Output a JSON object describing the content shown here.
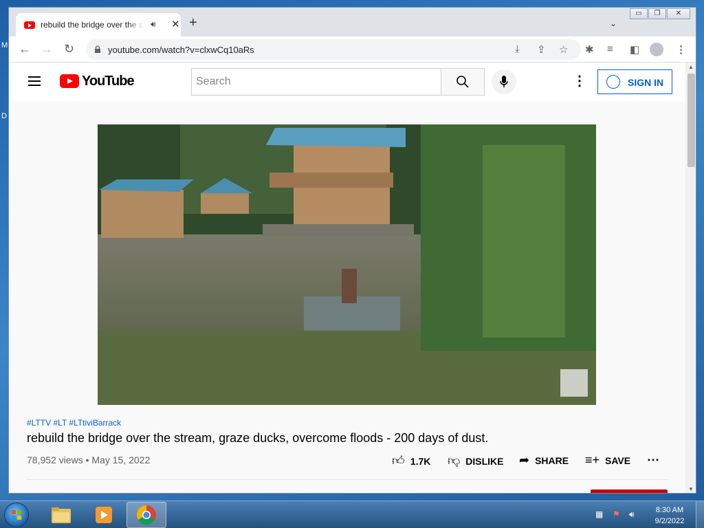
{
  "desktop": {
    "edge_letters": [
      "M",
      "D"
    ]
  },
  "browser": {
    "tab": {
      "title": "rebuild the bridge over the s",
      "audio_icon": "speaker-icon",
      "close_icon": "close-icon"
    },
    "window_controls": {
      "minimize": "▭",
      "restore": "❐",
      "close": "✕"
    },
    "url": "youtube.com/watch?v=clxwCq10aRs"
  },
  "youtube": {
    "logo_text": "YouTube",
    "search_placeholder": "Search",
    "signin_label": "SIGN IN",
    "video": {
      "hashtags": "#LTTV #LT #LTtiviBarrack",
      "title": "rebuild the bridge over the stream, graze ducks, overcome floods - 200 days of dust.",
      "meta": "78,952 views • May 15, 2022",
      "actions": {
        "like_count": "1.7K",
        "dislike": "DISLIKE",
        "share": "SHARE",
        "save": "SAVE"
      }
    }
  },
  "taskbar": {
    "time": "8:30 AM",
    "date": "9/2/2022"
  },
  "colors": {
    "youtube_red": "#ff0000",
    "link_blue": "#065fd4",
    "taskbar": "#2e5f91"
  }
}
